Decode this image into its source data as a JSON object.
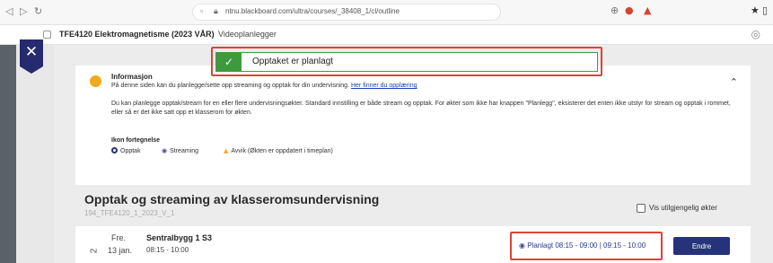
{
  "browser": {
    "url": "ntnu.blackboard.com/ultra/courses/_38408_1/cl/outline"
  },
  "course": {
    "title": "TFE4120 Elektromagnetisme (2023 VÅR)",
    "subtab": "Videoplanlegger"
  },
  "toast": {
    "message": "Opptaket er planlagt"
  },
  "info": {
    "heading": "Informasjon",
    "line1": "På denne siden kan du planlegge/sette opp streaming og opptak for din undervisning.",
    "line1_link": "Her finner du opplæring",
    "paragraph": "Du kan planlegge opptak/stream for en eller flere undervisningsøkter. Standard innstilling er både stream og opptak. For økter som ikke har knappen \"Planlegg\", eksisterer det enten ikke utstyr for stream og opptak i rommet, eller så er det ikke satt opp et klasserom for økten.",
    "legend_heading": "Ikon fortegnelse",
    "legend": {
      "opptak": "Opptak",
      "streaming": "Streaming",
      "avvik": "Avvik (Økten er oppdatert i timeplan)"
    }
  },
  "section": {
    "title": "Opptak og streaming av klasseromsundervisning",
    "subtitle": "194_TFE4120_1_2023_V_1",
    "show_unavailable_label": "Vis utilgjengelig økter",
    "show_unavailable_checked": false
  },
  "session": {
    "number": "2",
    "day": "Fre.",
    "date": "13 jan.",
    "room": "Sentralbygg 1 S3",
    "time": "08:15 - 10:00",
    "status": "Planlagt 08:15 - 09:00 | 09:15 - 10:00",
    "edit_label": "Endre"
  },
  "colors": {
    "accent": "#26327a",
    "success": "#3f9a3f",
    "highlight": "#e0413b",
    "warning": "#f4a81e"
  }
}
